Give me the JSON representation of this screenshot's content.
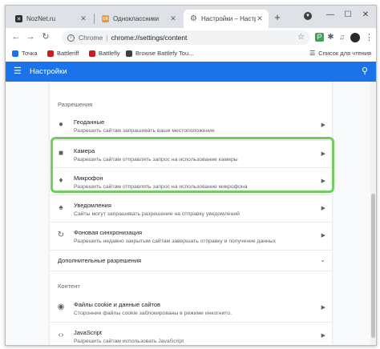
{
  "tabs": [
    {
      "title": "NozNet.ru",
      "favicon_color": "#2b2b2b",
      "active": false
    },
    {
      "title": "Одноклассники",
      "favicon_color": "#f7931e",
      "active": false
    },
    {
      "title": "Настройки – Настройки Google",
      "favicon_color": "#5f6368",
      "active": true
    }
  ],
  "toolbar": {
    "url_scheme": "Chrome",
    "url": "chrome://settings/content"
  },
  "bookmarks": [
    {
      "label": "Точка",
      "color": "#1a73e8"
    },
    {
      "label": "Battleriff",
      "color": "#c5221f"
    },
    {
      "label": "Battlefly",
      "color": "#c5221f"
    },
    {
      "label": "Browse Battlefy Tou...",
      "color": "#3c4043"
    }
  ],
  "reading_list": "Список для чтения",
  "header": {
    "title": "Настройки",
    "brand_color": "#1a73e8"
  },
  "sections": {
    "permissions_label": "Разрешения",
    "content_label": "Контент"
  },
  "items": [
    {
      "icon": "location-pin-icon",
      "title": "Геоданные",
      "desc": "Разрешить сайтам запрашивать ваше местоположение"
    },
    {
      "icon": "camera-icon",
      "title": "Камера",
      "desc": "Разрешить сайтам отправлять запрос на использование камеры"
    },
    {
      "icon": "microphone-icon",
      "title": "Микрофон",
      "desc": "Разрешить сайтам отправлять запрос на использование микрофона"
    },
    {
      "icon": "bell-icon",
      "title": "Уведомления",
      "desc": "Сайты могут запрашивать разрешение на отправку уведомлений"
    },
    {
      "icon": "sync-icon",
      "title": "Фоновая синхронизация",
      "desc": "Разрешить недавно закрытым сайтам завершать отправку и получение данных"
    }
  ],
  "additional_permissions": "Дополнительные разрешения",
  "content_items": [
    {
      "icon": "cookie-icon",
      "title": "Файлы cookie и данные сайтов",
      "desc": "Сторонние файлы cookie заблокированы в режиме инкогнито."
    },
    {
      "icon": "code-icon",
      "title": "JavaScript",
      "desc": "Разрешить сайтам использовать JavaScript"
    }
  ],
  "highlight_color": "#6fcf5a"
}
